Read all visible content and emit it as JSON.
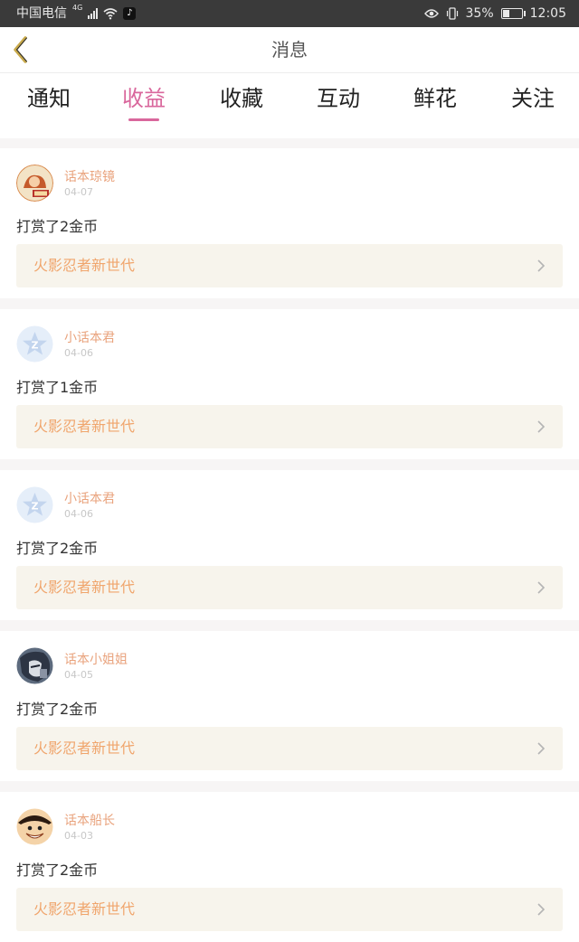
{
  "status_bar": {
    "carrier": "中国电信",
    "network": "4G",
    "battery": "35%",
    "battery_level": 0.35,
    "time": "12:05"
  },
  "nav": {
    "title": "消息"
  },
  "tabs": [
    {
      "label": "通知",
      "active": false
    },
    {
      "label": "收益",
      "active": true
    },
    {
      "label": "收藏",
      "active": false
    },
    {
      "label": "互动",
      "active": false
    },
    {
      "label": "鲜花",
      "active": false
    },
    {
      "label": "关注",
      "active": false
    }
  ],
  "items": [
    {
      "user": "话本琼镜",
      "date": "04-07",
      "action": "打赏了2金币",
      "work": "火影忍者新世代",
      "avatar": "manga-avatar"
    },
    {
      "user": "小话本君",
      "date": "04-06",
      "action": "打赏了1金币",
      "work": "火影忍者新世代",
      "avatar": "default-star-avatar"
    },
    {
      "user": "小话本君",
      "date": "04-06",
      "action": "打赏了2金币",
      "work": "火影忍者新世代",
      "avatar": "default-star-avatar"
    },
    {
      "user": "话本小姐姐",
      "date": "04-05",
      "action": "打赏了2金币",
      "work": "火影忍者新世代",
      "avatar": "anime-girl-avatar"
    },
    {
      "user": "话本船长",
      "date": "04-03",
      "action": "打赏了2金币",
      "work": "火影忍者新世代",
      "avatar": "luffy-avatar"
    }
  ],
  "colors": {
    "accent": "#d9679c",
    "username": "#e9a37d",
    "work_link": "#f0a56c",
    "link_bg": "#f7f4ec"
  }
}
